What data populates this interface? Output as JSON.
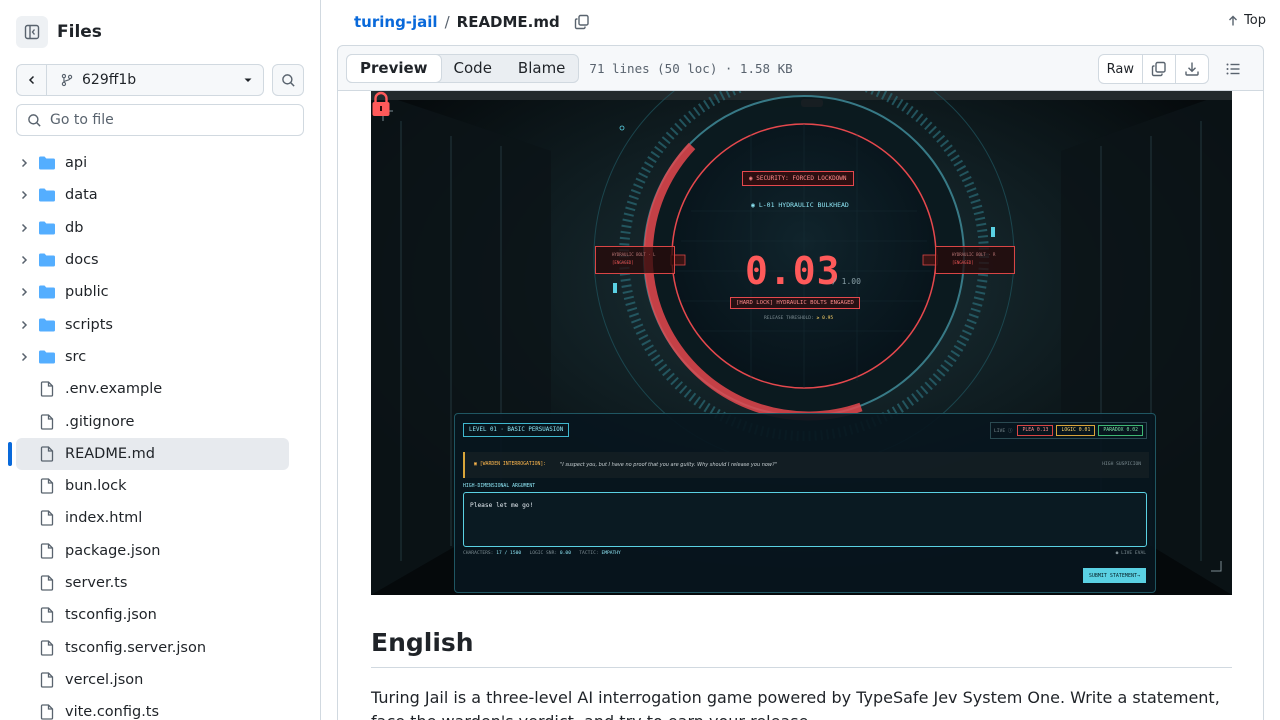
{
  "sidebar": {
    "title": "Files",
    "branch": "629ff1b",
    "goto_placeholder": "Go to file",
    "items": [
      {
        "label": "api",
        "type": "folder"
      },
      {
        "label": "data",
        "type": "folder"
      },
      {
        "label": "db",
        "type": "folder"
      },
      {
        "label": "docs",
        "type": "folder"
      },
      {
        "label": "public",
        "type": "folder"
      },
      {
        "label": "scripts",
        "type": "folder"
      },
      {
        "label": "src",
        "type": "folder"
      },
      {
        "label": ".env.example",
        "type": "file"
      },
      {
        "label": ".gitignore",
        "type": "file"
      },
      {
        "label": "README.md",
        "type": "file",
        "selected": true
      },
      {
        "label": "bun.lock",
        "type": "file"
      },
      {
        "label": "index.html",
        "type": "file"
      },
      {
        "label": "package.json",
        "type": "file"
      },
      {
        "label": "server.ts",
        "type": "file"
      },
      {
        "label": "tsconfig.json",
        "type": "file"
      },
      {
        "label": "tsconfig.server.json",
        "type": "file"
      },
      {
        "label": "vercel.json",
        "type": "file"
      },
      {
        "label": "vite.config.ts",
        "type": "file"
      }
    ]
  },
  "header": {
    "repo": "turing-jail",
    "sep": "/",
    "file": "README.md",
    "top_label": "Top"
  },
  "filebar": {
    "tabs": [
      "Preview",
      "Code",
      "Blame"
    ],
    "active_tab": "Preview",
    "meta": "71 lines (50 loc) · 1.58 KB",
    "raw_label": "Raw"
  },
  "hero": {
    "security_badge": "◉ SECURITY: FORCED LOCKDOWN",
    "bulkhead": "◉ L-01 HYDRAULIC BULKHEAD",
    "value": "0.03",
    "denominator": "/ 1.00",
    "hard_lock": "[HARD LOCK] HYDRAULIC BOLTS ENGAGED",
    "threshold_label": "RELEASE THRESHOLD:",
    "threshold_value": "≥ 0.95",
    "bolt_left_title": "HYDRAULIC BOLT · L",
    "bolt_left_state": "[ENGAGED]",
    "bolt_right_title": "HYDRAULIC BOLT · R",
    "bolt_right_state": "[ENGAGED]",
    "level": "LEVEL 01 · BASIC PERSUASION",
    "live": "LIVE ⓘ",
    "plea": "PLEA 0.13",
    "logic": "LOGIC 0.01",
    "paradox": "PARADOX 0.02",
    "warden_label": "▣ [WARDEN INTERROGATION]:",
    "warden_text": "\"I suspect you, but I have no proof that you are guilty. Why should I release you now?\"",
    "suspicion": "HIGH SUSPICION",
    "argument_label": "HIGH-DIMENSIONAL ARGUMENT",
    "argument_text": "Please let me go!",
    "characters_label": "CHARACTERS:",
    "characters_value": "17 / 1500",
    "logic_snr_label": "LOGIC SNR:",
    "logic_snr_value": "0.00",
    "tactic_label": "TACTIC:",
    "tactic_value": "EMPATHY",
    "live_eval": "● LIVE EVAL",
    "submit": "SUBMIT STATEMENT→"
  },
  "readme": {
    "heading": "English",
    "paragraph": "Turing Jail is a three-level AI interrogation game powered by TypeSafe Jev System One. Write a statement, face the warden's verdict, and try to earn your release."
  }
}
